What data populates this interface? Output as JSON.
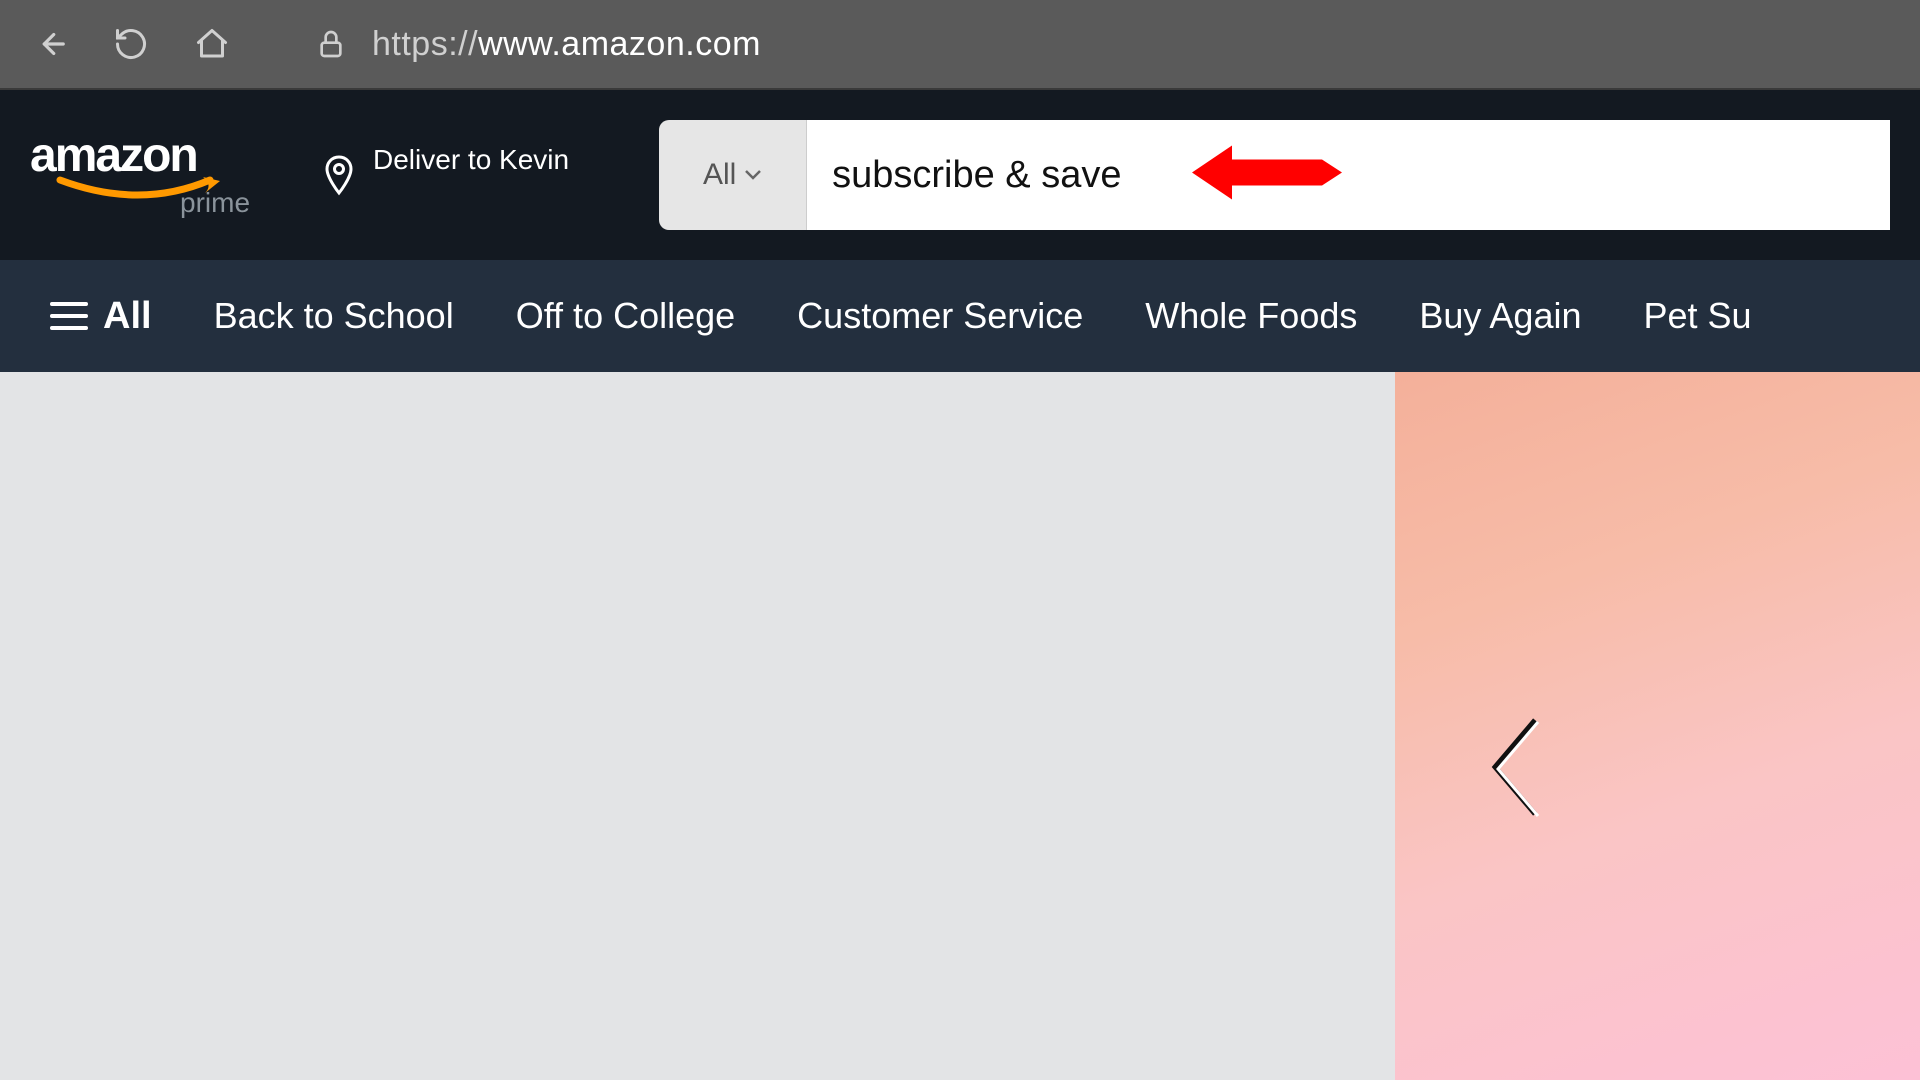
{
  "browser": {
    "url_prefix": "https://",
    "url_domain": "www.amazon.com",
    "url_path": ""
  },
  "header": {
    "logo_main": "amazon",
    "logo_sub": "prime",
    "deliver_label": "Deliver to Kevin",
    "search_dropdown_label": "All",
    "search_value": "subscribe & save"
  },
  "nav": {
    "all_label": "All",
    "items": [
      "Back to School",
      "Off to College",
      "Customer Service",
      "Whole Foods",
      "Buy Again",
      "Pet Su"
    ]
  }
}
